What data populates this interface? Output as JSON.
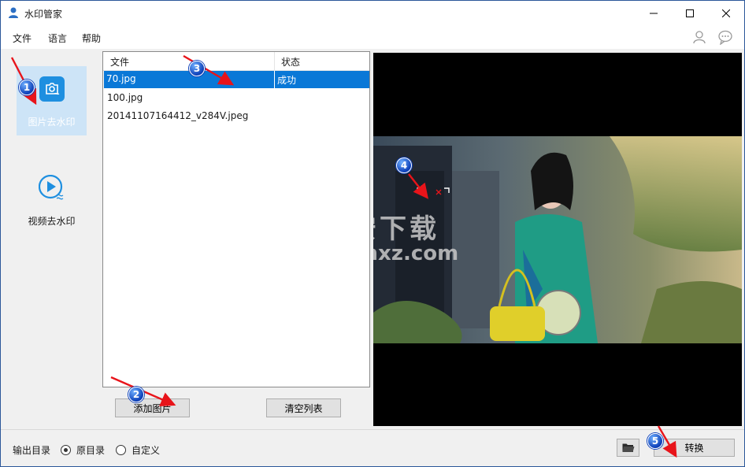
{
  "window": {
    "title": "水印管家"
  },
  "menu": {
    "items": [
      "文件",
      "语言",
      "帮助"
    ]
  },
  "sidebar": {
    "items": [
      {
        "label": "图片去水印",
        "icon": "image-watermark-icon",
        "active": true
      },
      {
        "label": "视频去水印",
        "icon": "video-watermark-icon",
        "active": false
      }
    ]
  },
  "file_list": {
    "columns": [
      "文件",
      "状态"
    ],
    "rows": [
      {
        "file": "70.jpg",
        "status": "成功",
        "selected": true
      },
      {
        "file": "100.jpg",
        "status": "",
        "selected": false
      },
      {
        "file": "20141107164412_v284V.jpeg",
        "status": "",
        "selected": false
      }
    ],
    "add_label": "添加图片",
    "clear_label": "清空列表"
  },
  "preview": {
    "watermark_line1": "安下载",
    "watermark_line2": "anxz.com"
  },
  "output": {
    "label": "输出目录",
    "options": [
      {
        "label": "原目录",
        "checked": true
      },
      {
        "label": "自定义",
        "checked": false
      }
    ],
    "convert_label": "转换"
  },
  "annotations": [
    "1",
    "2",
    "3",
    "4",
    "5"
  ],
  "colors": {
    "accent": "#0a78d7",
    "sidebar_active": "#cde4f7",
    "icon_blue": "#1e8fe0",
    "arrow_red": "#e8141a"
  }
}
